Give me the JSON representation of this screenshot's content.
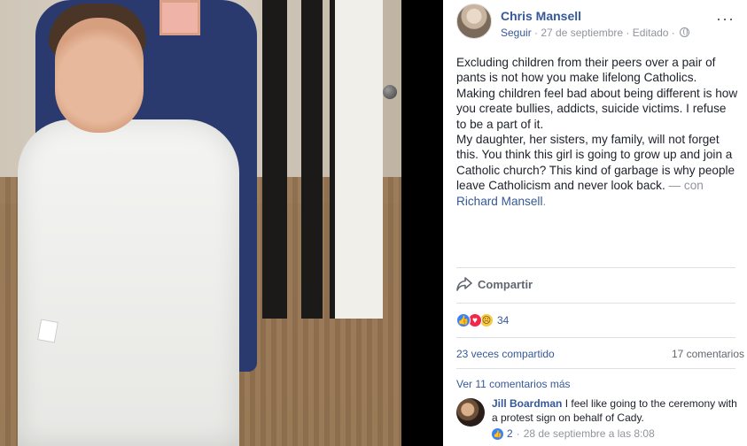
{
  "post": {
    "author": "Chris Mansell",
    "follow": "Seguir",
    "date": "27 de septiembre",
    "edited": "Editado",
    "visibility_icon": "globe-icon",
    "more_icon": "more-options-icon",
    "more_glyph": "···",
    "sep": " · ",
    "paragraphs": [
      "Excluding children from their peers over a pair of pants is not how you make lifelong Catholics. Making children feel bad about being different is how you create bullies, addicts, suicide victims. I refuse to be a part of it."
    ],
    "p2_text": "My daughter, her sisters, my family, will not forget this. You think this girl is going to grow up and join a Catholic church? This kind of garbage is why people leave Catholicism and never look back.",
    "with_label": "— con",
    "tagged": "Richard Mansell",
    "tagged_suffix": "."
  },
  "actions": {
    "share_label": "Compartir"
  },
  "reactions": {
    "count": "34",
    "types": [
      "like",
      "love",
      "sad"
    ]
  },
  "stats": {
    "shares": "23 veces compartido",
    "comments": "17 comentarios"
  },
  "comments": {
    "view_more": "Ver 11 comentarios más",
    "items": [
      {
        "name": "Jill Boardman",
        "text": "I feel like going to the ceremony with a protest sign on behalf of Cady.",
        "likes": "2",
        "timestamp": "28 de septiembre a las 8:08"
      }
    ]
  },
  "colors": {
    "link": "#365899",
    "meta": "#90949c",
    "like": "#3b82f6",
    "love": "#f0284a",
    "sad": "#f7c948"
  }
}
